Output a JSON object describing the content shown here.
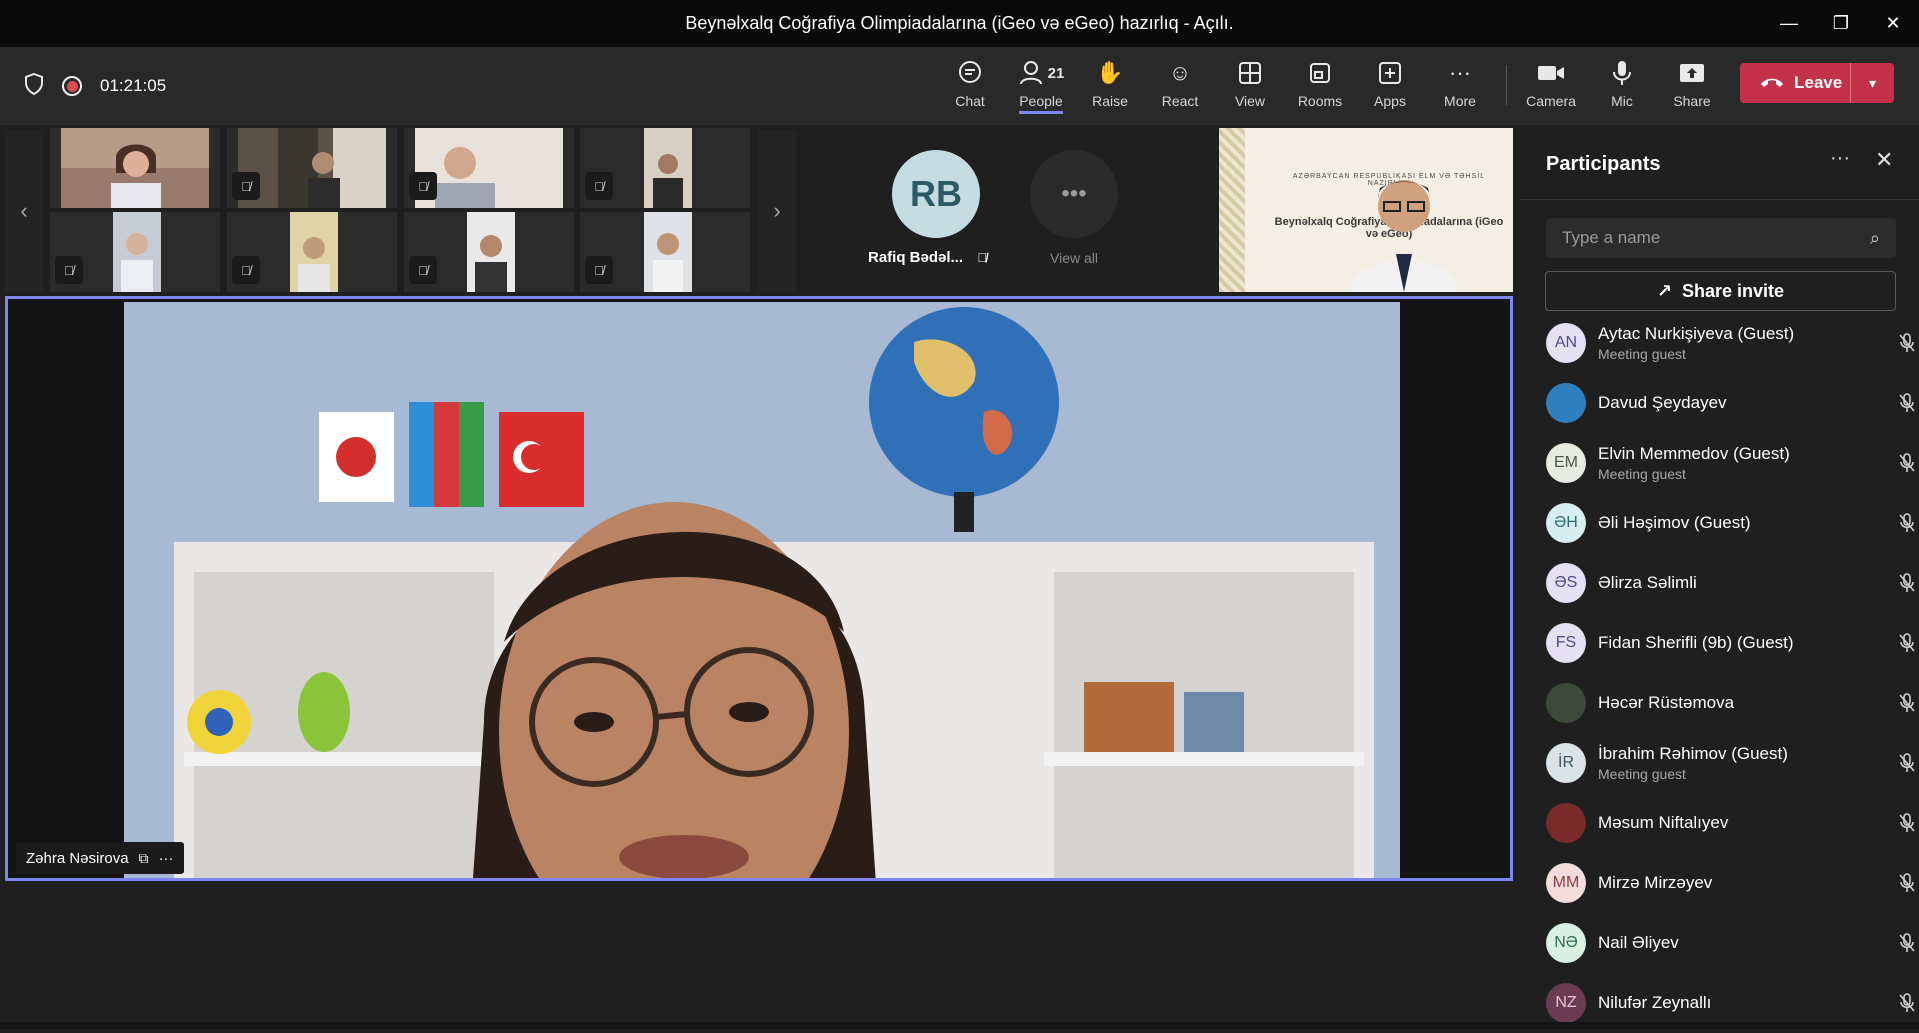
{
  "window": {
    "title": "Beynəlxalq Coğrafiya Olimpiadalarına (iGeo və eGeo) hazırlıq - Açılı.",
    "controls": [
      "—",
      "❐",
      "✕"
    ]
  },
  "toolbar": {
    "timer": "01:21:05",
    "chat_label": "Chat",
    "people_label": "People",
    "people_count": "21",
    "raise_label": "Raise",
    "react_label": "React",
    "view_label": "View",
    "rooms_label": "Rooms",
    "apps_label": "Apps",
    "more_label": "More",
    "camera_label": "Camera",
    "mic_label": "Mic",
    "share_label": "Share",
    "leave_label": "Leave",
    "accent": "#7f85f5",
    "leave_color": "#c4314b"
  },
  "gallery": {
    "rb_initials": "RB",
    "rb_name": "Rafiq Bədəl...",
    "view_all": "View all"
  },
  "slide": {
    "top_text": "AZƏRBAYCAN RESPUBLİKASI ELM VƏ TƏHSİL NAZİRLİYİ",
    "title_text": "Beynəlxalq Coğrafiya Olimpiadalarına (iGeo və eGeo)"
  },
  "main": {
    "speaker_name": "Zəhra Nəsirova"
  },
  "panel": {
    "title": "Participants",
    "search_placeholder": "Type a name",
    "share_invite": "Share invite",
    "participants": [
      {
        "initials": "AN",
        "name": "Aytac Nurkişiyeva (Guest)",
        "sub": "Meeting guest",
        "avatar_bg": "#e6e0f5",
        "avatar_fg": "#4f4a8c"
      },
      {
        "initials": "",
        "name": "Davud Şeydayev",
        "sub": "",
        "avatar_bg": "#2f7fbf",
        "avatar_fg": "#ffffff"
      },
      {
        "initials": "EM",
        "name": "Elvin Memmedov (Guest)",
        "sub": "Meeting guest",
        "avatar_bg": "#e7ece3",
        "avatar_fg": "#4d5b44"
      },
      {
        "initials": "ƏH",
        "name": "Əli Həşimov (Guest)",
        "sub": "",
        "avatar_bg": "#d6eef1",
        "avatar_fg": "#2e6b75"
      },
      {
        "initials": "ƏS",
        "name": "Əlirza Səlimli",
        "sub": "",
        "avatar_bg": "#e6e0f5",
        "avatar_fg": "#4f4a8c"
      },
      {
        "initials": "FS",
        "name": "Fidan Sherifli (9b) (Guest)",
        "sub": "",
        "avatar_bg": "#e6e0f5",
        "avatar_fg": "#4f4a8c"
      },
      {
        "initials": "",
        "name": "Həcər Rüstəmova",
        "sub": "",
        "avatar_bg": "#3d4a3a",
        "avatar_fg": "#ffffff"
      },
      {
        "initials": "İR",
        "name": "İbrahim Rəhimov (Guest)",
        "sub": "Meeting guest",
        "avatar_bg": "#dbe3e6",
        "avatar_fg": "#3e5863"
      },
      {
        "initials": "",
        "name": "Məsum Niftalıyev",
        "sub": "",
        "avatar_bg": "#7a2a2a",
        "avatar_fg": "#ffffff"
      },
      {
        "initials": "MM",
        "name": "Mirzə Mirzəyev",
        "sub": "",
        "avatar_bg": "#f3dcdc",
        "avatar_fg": "#8a3f3f"
      },
      {
        "initials": "NƏ",
        "name": "Nail Əliyev",
        "sub": "",
        "avatar_bg": "#d9f0e3",
        "avatar_fg": "#2f6e4b"
      },
      {
        "initials": "NZ",
        "name": "Nilufər Zeynallı",
        "sub": "",
        "avatar_bg": "#6b3b52",
        "avatar_fg": "#e8c7d6"
      }
    ]
  }
}
